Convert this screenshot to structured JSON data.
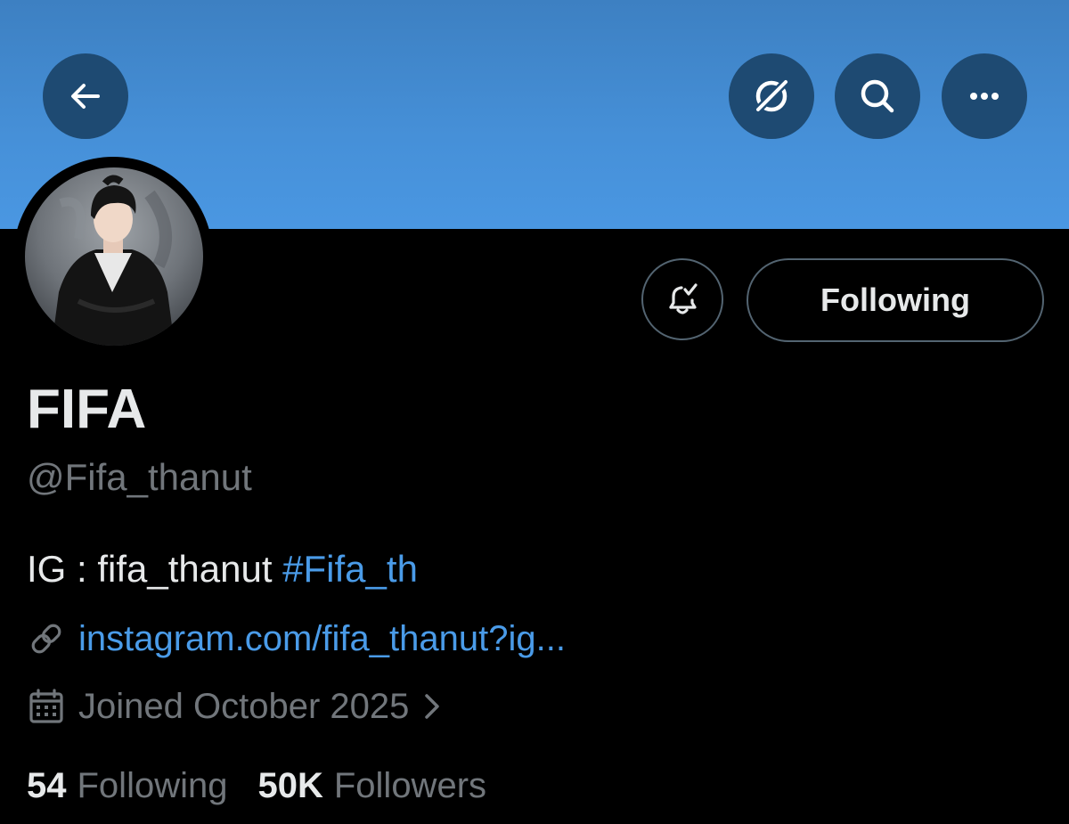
{
  "header": {
    "back_icon": "arrow-left-icon",
    "grok_icon": "grok-icon",
    "search_icon": "search-icon",
    "more_icon": "more-horizontal-icon",
    "banner_color": "#4690d8"
  },
  "actions": {
    "notifications_icon": "bell-check-icon",
    "follow_label": "Following"
  },
  "profile": {
    "display_name": "FIFA",
    "handle": "@Fifa_thanut",
    "bio_text": "IG : fifa_thanut ",
    "bio_hashtag": "#Fifa_th",
    "link": "instagram.com/fifa_thanut?ig...",
    "joined": "Joined October 2025"
  },
  "stats": {
    "following_count": "54",
    "following_label": "Following",
    "followers_count": "50K",
    "followers_label": "Followers"
  },
  "colors": {
    "background": "#000000",
    "link": "#4a9be8",
    "secondary_text": "#71767b",
    "primary_text": "#e7e9ea"
  }
}
